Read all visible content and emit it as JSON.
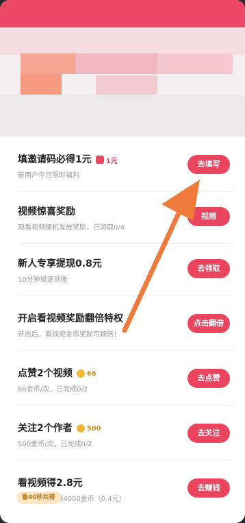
{
  "tasks": [
    {
      "title": "填邀请码必得1元",
      "badge": "1元",
      "badge_type": "redpack",
      "subtitle": "新用户今日限时福利",
      "button": "去填写"
    },
    {
      "title": "视频惊喜奖励",
      "badge": "",
      "badge_type": "",
      "subtitle": "观看视频随机发放奖励，已领取0/4",
      "button": "视频"
    },
    {
      "title": "新人专享提现0.8元",
      "badge": "",
      "badge_type": "",
      "subtitle": "10分钟极速到账",
      "button": "去领取"
    },
    {
      "title": "开启看视频奖励翻倍特权",
      "badge": "",
      "badge_type": "",
      "subtitle": "开启后，看视频金币奖励可翻倍！",
      "button": "点击翻倍"
    },
    {
      "title": "点赞2个视频",
      "badge": "66",
      "badge_type": "coin",
      "subtitle": "66金币/次，已完成0/2",
      "button": "去点赞"
    },
    {
      "title": "关注2个作者",
      "badge": "500",
      "badge_type": "coin",
      "subtitle": "500金币/次，已完成0/2",
      "button": "去关注"
    },
    {
      "title": "看视频得2.8元",
      "badge": "",
      "badge_type": "",
      "subtitle": "今天看6分钟得4000金币（0.4元）",
      "button": "去赚钱"
    }
  ],
  "tag_label": "看40秒共得",
  "colors": {
    "accent": "#e9455f",
    "arrow": "#f07a3c",
    "coin": "#f2b737"
  }
}
